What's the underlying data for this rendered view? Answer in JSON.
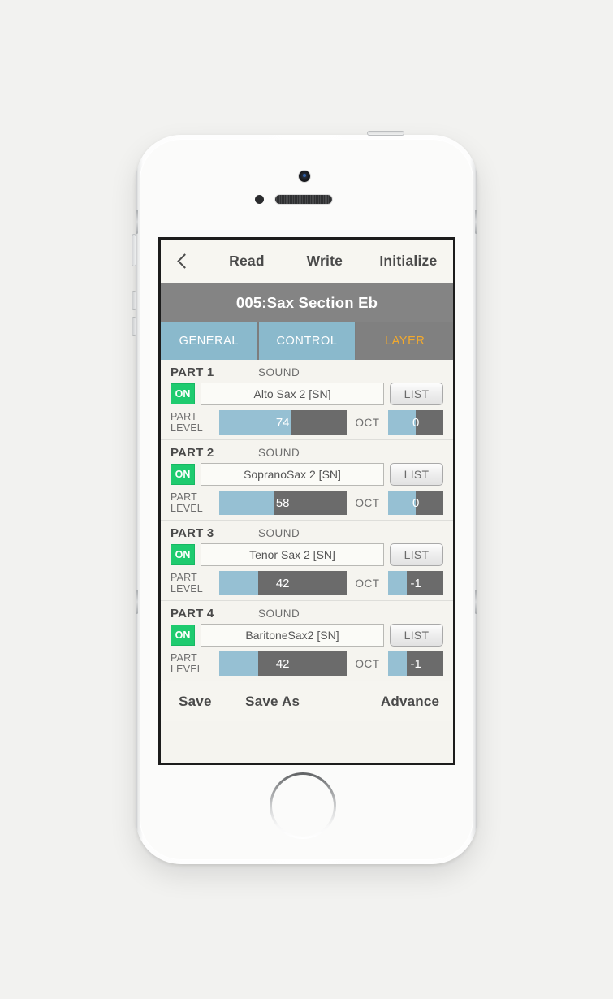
{
  "device": {
    "type": "smartphone-white",
    "icons": {
      "camera": "front-camera-icon",
      "sensor": "proximity-sensor-icon",
      "speaker": "earpiece-speaker-icon",
      "home": "home-button-icon"
    }
  },
  "navbar": {
    "back_icon": "chevron-left-icon",
    "read": "Read",
    "write": "Write",
    "initialize": "Initialize"
  },
  "patch": {
    "name": "005:Sax Section Eb"
  },
  "tabs": [
    {
      "label": "GENERAL",
      "active": false
    },
    {
      "label": "CONTROL",
      "active": false
    },
    {
      "label": "LAYER",
      "active": true
    }
  ],
  "labels": {
    "sound": "SOUND",
    "part_level_line1": "PART",
    "part_level_line2": "LEVEL",
    "oct": "OCT",
    "list": "LIST",
    "on": "ON"
  },
  "parts": [
    {
      "title": "PART 1",
      "on": "ON",
      "sound": "Alto Sax 2 [SN]",
      "list": "LIST",
      "level_value": "74",
      "level_pct": 57,
      "oct_value": "0",
      "oct_pct": 50
    },
    {
      "title": "PART 2",
      "on": "ON",
      "sound": "SopranoSax 2 [SN]",
      "list": "LIST",
      "level_value": "58",
      "level_pct": 43,
      "oct_value": "0",
      "oct_pct": 50
    },
    {
      "title": "PART 3",
      "on": "ON",
      "sound": "Tenor Sax 2 [SN]",
      "list": "LIST",
      "level_value": "42",
      "level_pct": 31,
      "oct_value": "-1",
      "oct_pct": 33
    },
    {
      "title": "PART 4",
      "on": "ON",
      "sound": "BaritoneSax2 [SN]",
      "list": "LIST",
      "level_value": "42",
      "level_pct": 31,
      "oct_value": "-1",
      "oct_pct": 33
    }
  ],
  "bottombar": {
    "save": "Save",
    "save_as": "Save As",
    "advance": "Advance"
  },
  "colors": {
    "tab_inactive_bg": "#8ab9cc",
    "tab_active_bg": "#808080",
    "tab_active_text": "#f2a92d",
    "patchbar_bg": "#848484",
    "on_badge": "#1ecb6f",
    "slider_fill": "#96c0d3",
    "slider_track": "#6b6b6b",
    "screen_bg": "#f5f4ef"
  }
}
